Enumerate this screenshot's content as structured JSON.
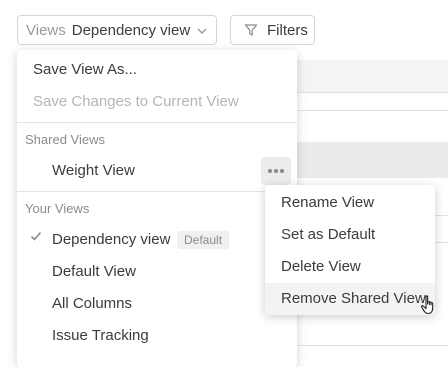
{
  "toolbar": {
    "views_label": "Views",
    "views_value": "Dependency view",
    "filters_label": "Filters"
  },
  "menu": {
    "save_as": "Save View As...",
    "save_changes": "Save Changes to Current View",
    "shared_header": "Shared Views",
    "shared_items": [
      "Weight View"
    ],
    "your_header": "Your Views",
    "your_items": [
      "Dependency view",
      "Default View",
      "All Columns",
      "Issue Tracking"
    ],
    "default_badge": "Default",
    "selected_item": "Dependency view"
  },
  "submenu": {
    "items": [
      "Rename View",
      "Set as Default",
      "Delete View",
      "Remove Shared View"
    ],
    "hovered": "Remove Shared View"
  },
  "colors": {
    "menu_bg": "#ffffff",
    "hover_bg": "#f3f3f3",
    "disabled_text": "#b5b5b5",
    "muted_text": "#8c8c8c"
  },
  "icons": {
    "views_chevron": "chevron-down-icon",
    "filters": "filter-icon",
    "selected": "check-icon",
    "more": "more-horizontal-icon",
    "cursor": "hand-pointer-icon"
  }
}
